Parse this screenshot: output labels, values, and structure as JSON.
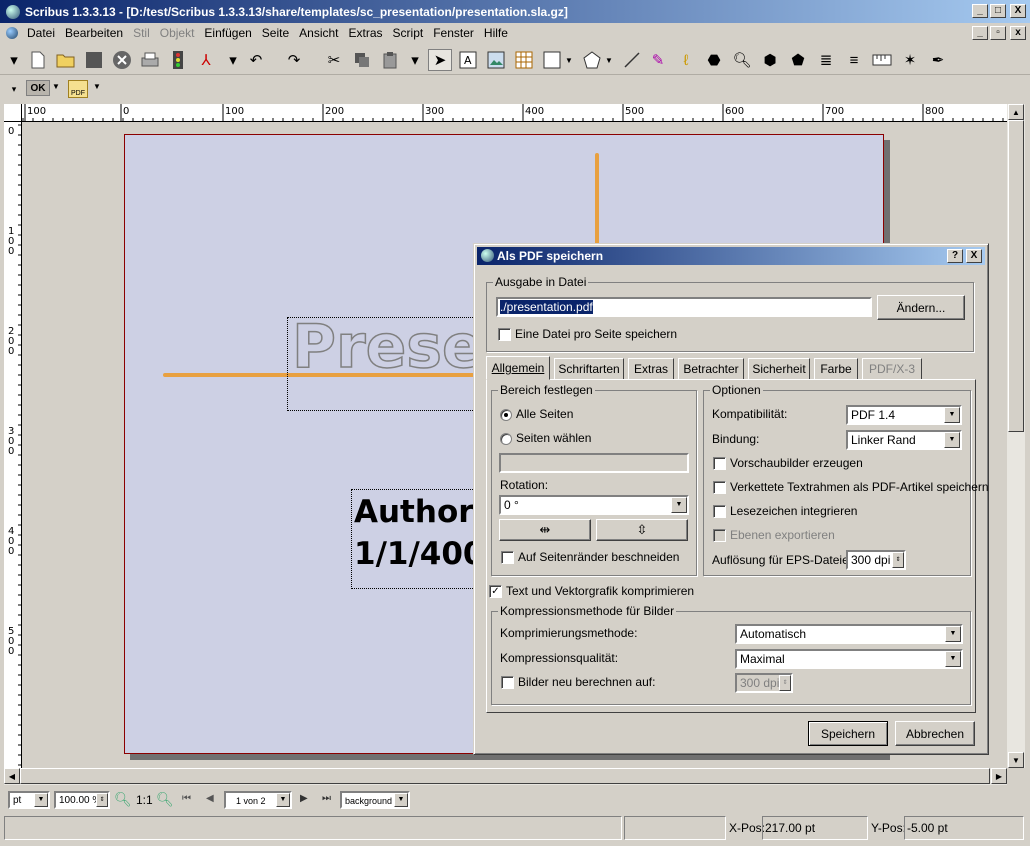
{
  "window": {
    "title": "Scribus 1.3.3.13 - [D:/test/Scribus 1.3.3.13/share/templates/sc_presentation/presentation.sla.gz]",
    "minimize": "_",
    "maximize": "□",
    "close": "X"
  },
  "menu": {
    "items": [
      "Datei",
      "Bearbeiten",
      "Stil",
      "Objekt",
      "Einfügen",
      "Seite",
      "Ansicht",
      "Extras",
      "Script",
      "Fenster",
      "Hilfe"
    ]
  },
  "toolbar2": {
    "ok_label": "OK",
    "pdf_label": "PDF"
  },
  "ruler": {
    "h_labels": [
      "100",
      "0",
      "100",
      "200",
      "300",
      "400",
      "500",
      "600",
      "700",
      "800"
    ],
    "v_labels": [
      "0",
      "100",
      "200",
      "300",
      "400",
      "500"
    ]
  },
  "page": {
    "title_text": "Prese",
    "author_line1": "Author",
    "author_line2": "1/1/400"
  },
  "colors": {
    "page_bg": "#cdd0e4",
    "orange_line": "#e8a040",
    "title_bar": "#0a246a"
  },
  "bottom": {
    "unit": "pt",
    "zoom": "100.00 %",
    "zoom_ratio": "1:1",
    "page_selector": "1 von 2",
    "layer": "background"
  },
  "status": {
    "x_label": "X-Pos:",
    "x_value": "217.00 pt",
    "y_label": "Y-Pos:",
    "y_value": "-5.00 pt"
  },
  "dialog": {
    "title": "Als PDF speichern",
    "help_btn": "?",
    "close_btn": "X",
    "output_group": "Ausgabe in Datei",
    "output_path": "./presentation.pdf",
    "change_btn": "Ändern...",
    "one_file_per_page": "Eine Datei pro Seite speichern",
    "tabs": [
      "Allgemein",
      "Schriftarten",
      "Extras",
      "Betrachter",
      "Sicherheit",
      "Farbe",
      "PDF/X-3"
    ],
    "range_group": "Bereich festlegen",
    "all_pages": "Alle Seiten",
    "select_pages": "Seiten wählen",
    "rotation_label": "Rotation:",
    "rotation_value": "0 °",
    "clip_margins": "Auf Seitenränder beschneiden",
    "options_group": "Optionen",
    "compat_label": "Kompatibilität:",
    "compat_value": "PDF 1.4",
    "binding_label": "Bindung:",
    "binding_value": "Linker Rand",
    "thumbnails": "Vorschaubilder erzeugen",
    "linked_frames": "Verkettete Textrahmen als PDF-Artikel speichern",
    "bookmarks": "Lesezeichen integrieren",
    "export_layers": "Ebenen exportieren",
    "eps_res_label": "Auflösung für EPS-Dateien:",
    "eps_res_value": "300 dpi",
    "compress_text": "Text und Vektorgrafik komprimieren",
    "img_compress_group": "Kompressionsmethode für Bilder",
    "compress_method_label": "Komprimierungsmethode:",
    "compress_method_value": "Automatisch",
    "compress_quality_label": "Kompressionsqualität:",
    "compress_quality_value": "Maximal",
    "resample_label": "Bilder neu berechnen auf:",
    "resample_value": "300 dpi",
    "save_btn": "Speichern",
    "cancel_btn": "Abbrechen"
  }
}
